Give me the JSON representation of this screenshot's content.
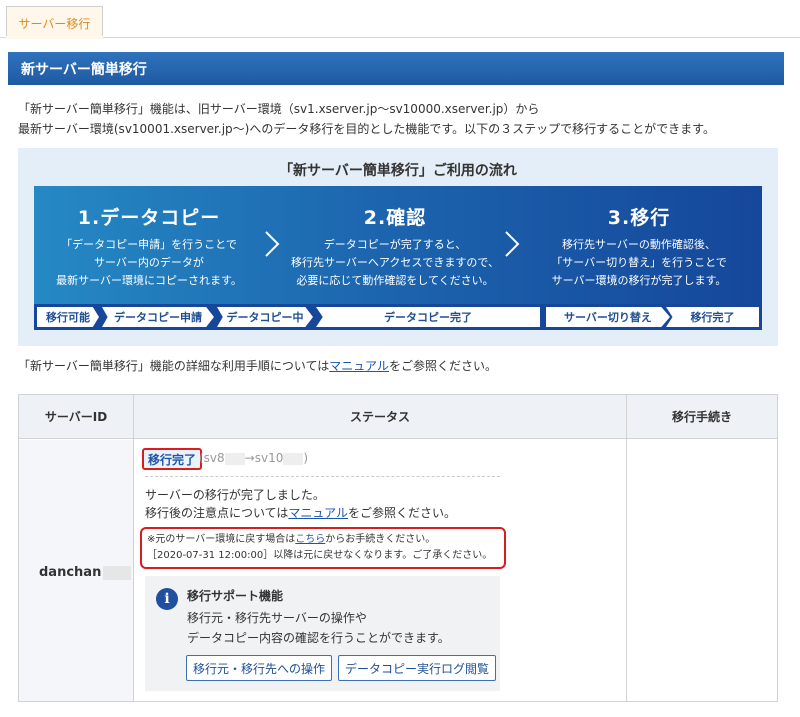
{
  "tab": {
    "label": "サーバー移行"
  },
  "header": {
    "title": "新サーバー簡単移行"
  },
  "intro": {
    "line1": "「新サーバー簡単移行」機能は、旧サーバー環境（sv1.xserver.jp～sv10000.xserver.jp）から",
    "line2": "最新サーバー環境(sv10001.xserver.jp～)へのデータ移行を目的とした機能です。以下の３ステップで移行することができます。"
  },
  "flow": {
    "title": "「新サーバー簡単移行」ご利用の流れ",
    "steps": [
      {
        "title": "1.データコピー",
        "desc1": "「データコピー申請」を行うことで",
        "desc2": "サーバー内のデータが",
        "desc3": "最新サーバー環境にコピーされます。"
      },
      {
        "title": "2.確認",
        "desc1": "データコピーが完了すると、",
        "desc2": "移行先サーバーへアクセスできますので、",
        "desc3": "必要に応じて動作確認をしてください。"
      },
      {
        "title": "3.移行",
        "desc1": "移行先サーバーの動作確認後、",
        "desc2": "「サーバー切り替え」を行うことで",
        "desc3": "サーバー環境の移行が完了します。"
      }
    ],
    "stages": [
      "移行可能",
      "データコピー申請",
      "データコピー中",
      "データコピー完了",
      "サーバー切り替え",
      "移行完了"
    ]
  },
  "manual_line": {
    "prefix": "「新サーバー簡単移行」機能の詳細な利用手順については",
    "link": "マニュアル",
    "suffix": "をご参照ください。"
  },
  "table": {
    "headers": {
      "server_id": "サーバーID",
      "status": "ステータス",
      "procedure": "移行手続き"
    },
    "row": {
      "server_id": "danchan",
      "status_badge": "移行完了",
      "route_prefix": "(sv8",
      "route_arrow": "→sv10",
      "route_suffix": ")",
      "done_line1": "サーバーの移行が完了しました。",
      "done_line2_prefix": "移行後の注意点については",
      "done_line2_link": "マニュアル",
      "done_line2_suffix": "をご参照ください。",
      "notice_line1_prefix": "※元のサーバー環境に戻す場合は",
      "notice_line1_link": "こちら",
      "notice_line1_suffix": "からお手続きください。",
      "notice_line2": "［2020-07-31 12:00:00］以降は元に戻せなくなります。ご了承ください。",
      "support_title": "移行サポート機能",
      "support_desc1": "移行元・移行先サーバーの操作や",
      "support_desc2": "データコピー内容の確認を行うことができます。",
      "btn_operate": "移行元・移行先への操作",
      "btn_log": "データコピー実行ログ閲覧"
    }
  },
  "colors": {
    "accent_blue": "#1f5aa3",
    "tab_orange": "#e08a1c",
    "alert_red": "#d91c1c"
  }
}
